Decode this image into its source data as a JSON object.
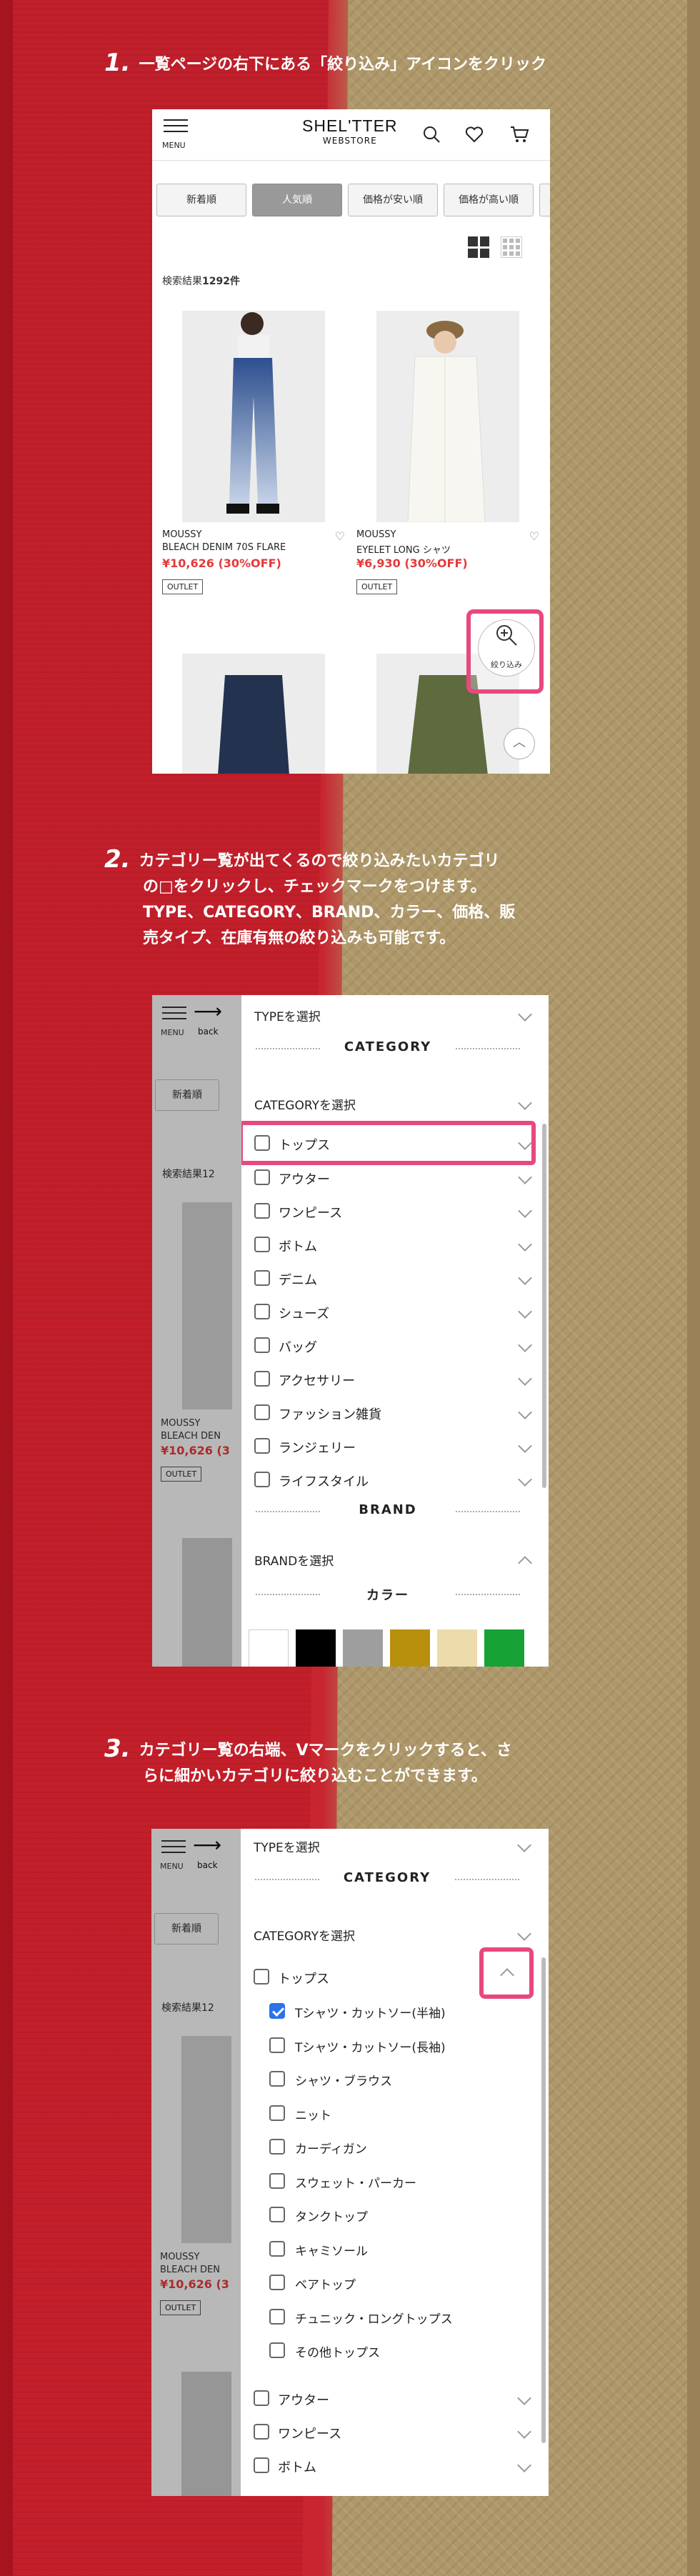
{
  "steps": [
    {
      "num": "1.",
      "text": "一覧ページの右下にある「絞り込み」アイコンをクリック"
    },
    {
      "num": "2.",
      "lines": [
        "カテゴリー覧が出てくるので絞り込みたいカテゴリ",
        "の□をクリックし、チェックマークをつけます。",
        "TYPE、CATEGORY、BRAND、カラー、価格、販",
        "売タイプ、在庫有無の絞り込みも可能です。"
      ]
    },
    {
      "num": "3.",
      "lines": [
        "カテゴリー覧の右端、Vマークをクリックすると、さ",
        "らに細かいカテゴリに絞り込むことができます。"
      ]
    }
  ],
  "shot1": {
    "menu_label": "MENU",
    "logo_top": "SHEL'TTER",
    "logo_bottom": "WEBSTORE",
    "sort_buttons": [
      "新着順",
      "人気順",
      "価格が安い順",
      "価格が高い順"
    ],
    "count_prefix": "検索結果",
    "count_value": "1292件",
    "products": [
      {
        "brand": "MOUSSY",
        "name": "BLEACH DENIM 70S FLARE",
        "price": "¥10,626 (30%OFF)",
        "tag": "OUTLET"
      },
      {
        "brand": "MOUSSY",
        "name": "EYELET LONG シャツ",
        "price": "¥6,930 (30%OFF)",
        "tag": "OUTLET"
      }
    ],
    "filter_label": "絞り込み"
  },
  "bgpage": {
    "menu_label": "MENU",
    "back_label": "back",
    "sort_label": "新着順",
    "count_text": "検索結果12",
    "brand": "MOUSSY",
    "name": "BLEACH DEN",
    "price": "¥10,626 (3",
    "tag": "OUTLET"
  },
  "shot2": {
    "type_select": "TYPEを選択",
    "category_title": "CATEGORY",
    "category_select": "CATEGORYを選択",
    "categories": [
      "トップス",
      "アウター",
      "ワンピース",
      "ボトム",
      "デニム",
      "シューズ",
      "バッグ",
      "アクセサリー",
      "ファッション雑貨",
      "ランジェリー",
      "ライフスタイル"
    ],
    "brand_title": "BRAND",
    "brand_select": "BRANDを選択",
    "color_title": "カラー",
    "colors": [
      "#ffffff",
      "#000000",
      "#9e9e9e",
      "#b8900e",
      "#ecdcab",
      "#16a235"
    ]
  },
  "shot3": {
    "type_select": "TYPEを選択",
    "category_title": "CATEGORY",
    "category_select": "CATEGORYを選択",
    "parent": "トップス",
    "subcategories": [
      {
        "label": "Tシャツ・カットソー(半袖)",
        "checked": true
      },
      {
        "label": "Tシャツ・カットソー(長袖)",
        "checked": false
      },
      {
        "label": "シャツ・ブラウス",
        "checked": false
      },
      {
        "label": "ニット",
        "checked": false
      },
      {
        "label": "カーディガン",
        "checked": false
      },
      {
        "label": "スウェット・パーカー",
        "checked": false
      },
      {
        "label": "タンクトップ",
        "checked": false
      },
      {
        "label": "キャミソール",
        "checked": false
      },
      {
        "label": "ベアトップ",
        "checked": false
      },
      {
        "label": "チュニック・ロングトップス",
        "checked": false
      },
      {
        "label": "その他トップス",
        "checked": false
      }
    ],
    "after": [
      "アウター",
      "ワンピース",
      "ボトム"
    ]
  },
  "accent": "#e84880"
}
